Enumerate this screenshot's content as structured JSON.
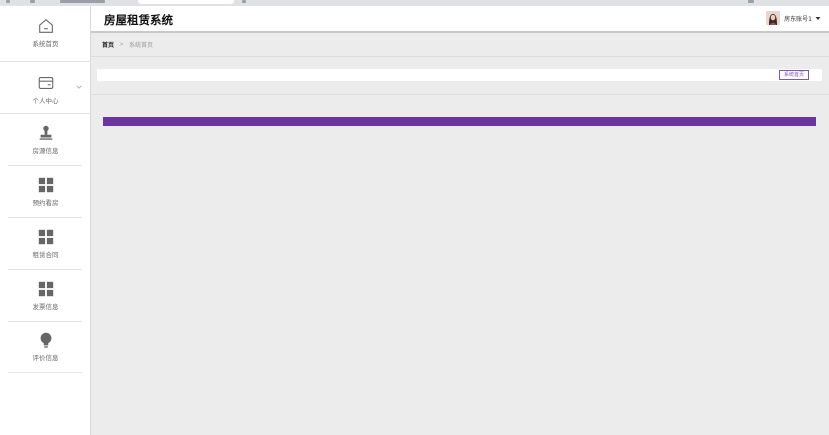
{
  "header": {
    "app_title": "房屋租赁系统",
    "user_name": "房东账号1"
  },
  "breadcrumb": {
    "home": "首页",
    "separator": ">",
    "current": "系统首页"
  },
  "tabbar": {
    "tab_label": "系统首页"
  },
  "sidebar": {
    "items": [
      {
        "label": "系统首页",
        "icon": "home-icon"
      },
      {
        "label": "个人中心",
        "icon": "wallet-icon",
        "expandable": true
      },
      {
        "label": "房源信息",
        "icon": "stamp-icon"
      },
      {
        "label": "预约看房",
        "icon": "grid-icon"
      },
      {
        "label": "租赁合同",
        "icon": "grid-icon"
      },
      {
        "label": "发票信息",
        "icon": "grid-icon"
      },
      {
        "label": "评价信息",
        "icon": "lightbulb-icon"
      }
    ]
  },
  "colors": {
    "accent": "#6b35a0",
    "tab_border": "#7b58b7",
    "background": "#ececec"
  }
}
